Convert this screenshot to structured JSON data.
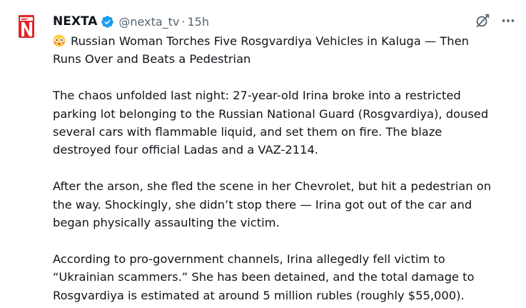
{
  "author": {
    "name": "NEXTA",
    "handle": "@nexta_tv",
    "separator": "·",
    "time": "15h",
    "verified": true,
    "avatar_letter": "N",
    "brand_color": "#e0262b"
  },
  "icons": [
    "grok-icon",
    "more-icon",
    "flushed-face-emoji",
    "verified-badge-icon"
  ],
  "post": {
    "lines": [
      "Russian Woman Torches Five Rosgvardiya Vehicles in Kaluga — Then",
      "Runs Over and Beats a Pedestrian",
      "",
      "The chaos unfolded last night: 27-year-old Irina broke into a restricted",
      "parking lot belonging to the Russian National Guard (Rosgvardiya), doused",
      "several cars with flammable liquid, and set them on fire. The blaze",
      "destroyed four official Ladas and a VAZ-2114.",
      "",
      "After the arson, she fled the scene in her Chevrolet, but hit a pedestrian on",
      "the way. Shockingly, she didn’t stop there — Irina got out of the car and",
      "began physically assaulting the victim.",
      "",
      "According to pro-government channels, Irina allegedly fell victim to",
      "“Ukrainian scammers.” She has been detained, and the total damage to",
      "Rosgvardiya is estimated at around 5 million rubles (roughly $55,000)."
    ]
  },
  "colors": {
    "text": "#0f1419",
    "secondary": "#536471",
    "verified_blue": "#1d9bf0"
  }
}
